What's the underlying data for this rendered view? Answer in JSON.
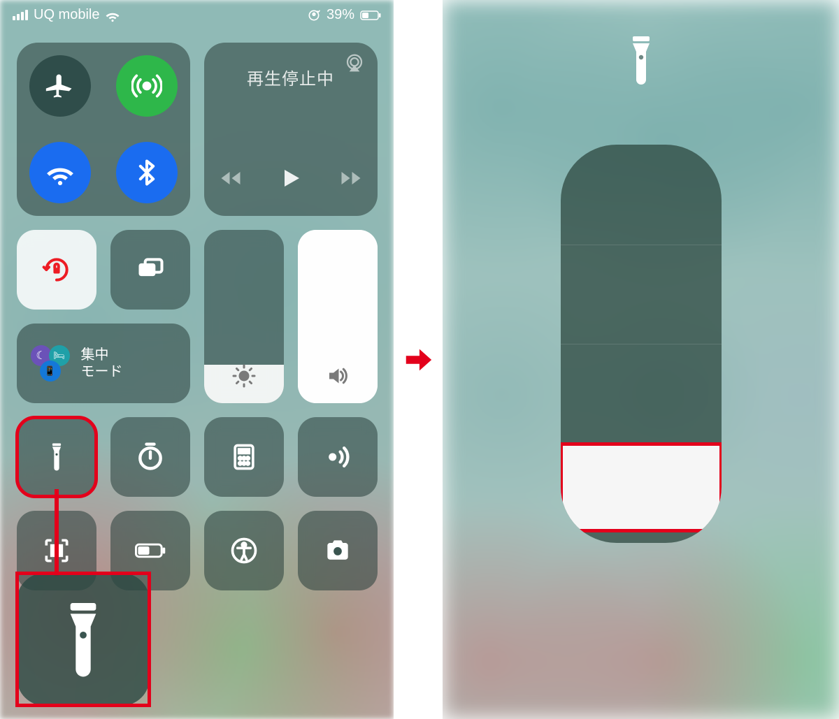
{
  "status": {
    "carrier": "UQ mobile",
    "battery_text": "39%"
  },
  "control_center": {
    "media_status": "再生停止中",
    "focus_line1": "集中",
    "focus_line2": "モード",
    "brightness_pct": 22,
    "volume_pct": 100
  },
  "flashlight_detail": {
    "level_count": 4,
    "active_level": 1
  }
}
